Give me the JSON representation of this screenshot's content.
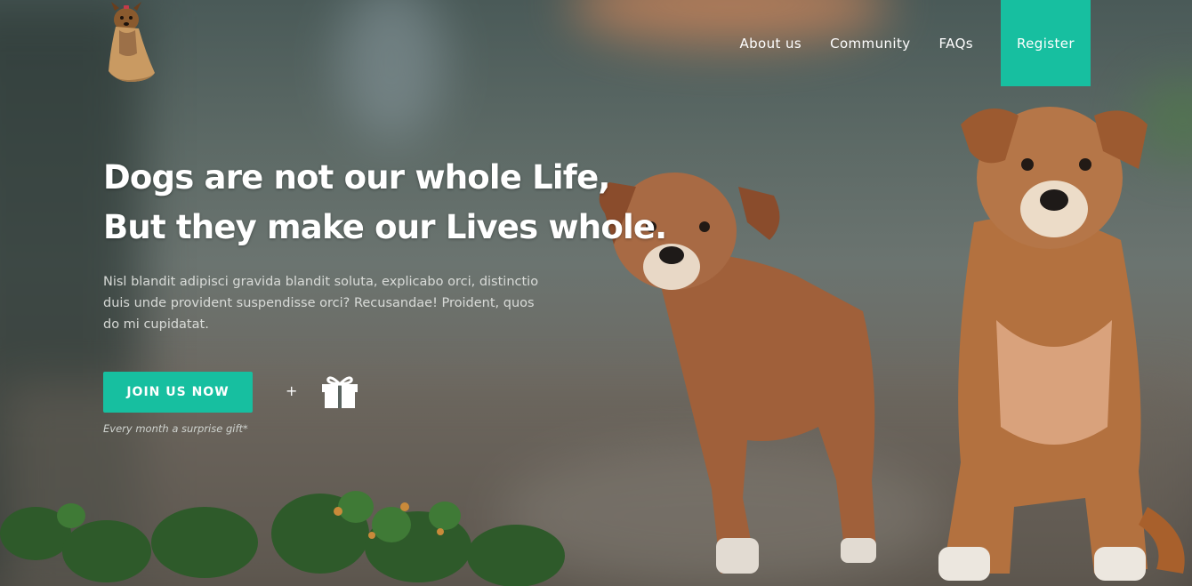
{
  "nav": {
    "about_label": "About us",
    "community_label": "Community",
    "faqs_label": "FAQs",
    "register_label": "Register"
  },
  "hero": {
    "headline_line1": "Dogs are not our whole Life,",
    "headline_line2": "But they make our Lives whole.",
    "paragraph": "Nisl blandit adipisci gravida blandit soluta, explicabo orci, distinctio duis unde provident suspendisse orci? Recusandae! Proident, quos do mi cupidatat.",
    "cta_label": "JOIN US NOW",
    "plus_text": "+",
    "gift_note": "Every month a surprise gift*"
  },
  "icons": {
    "logo": "yorkshire-terrier-logo",
    "gift": "gift-icon"
  },
  "colors": {
    "accent": "#17bfa0",
    "text": "#ffffff"
  }
}
